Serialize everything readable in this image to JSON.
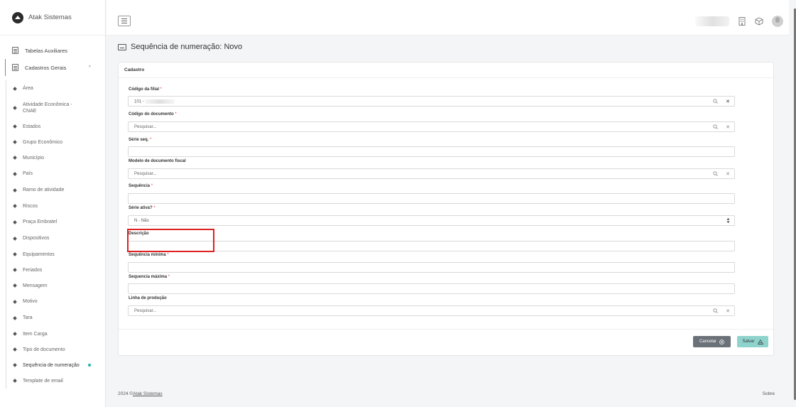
{
  "brand": {
    "name": "Atak Sistemas"
  },
  "sidebar": {
    "sections": [
      {
        "label": "Tabelas Auxiliares"
      },
      {
        "label": "Cadastros Gerais"
      }
    ],
    "items": [
      {
        "label": "Área"
      },
      {
        "label": "Atividade Econômica - CNAE"
      },
      {
        "label": "Estados"
      },
      {
        "label": "Grupo Econômico"
      },
      {
        "label": "Município"
      },
      {
        "label": "País"
      },
      {
        "label": "Ramo de atividade"
      },
      {
        "label": "Riscos"
      },
      {
        "label": "Praça Embratel"
      },
      {
        "label": "Dispositivos"
      },
      {
        "label": "Equipamentos"
      },
      {
        "label": "Feriados"
      },
      {
        "label": "Mensagem"
      },
      {
        "label": "Motivo"
      },
      {
        "label": "Tara"
      },
      {
        "label": "Item Carga"
      },
      {
        "label": "Tipo de documento"
      },
      {
        "label": "Sequência de numeração"
      },
      {
        "label": "Template de email"
      }
    ],
    "active_item": "Sequência de numeração"
  },
  "page": {
    "title": "Sequência de numeração: Novo"
  },
  "form": {
    "card_title": "Cadastro",
    "fields": {
      "filial": {
        "label": "Código da filial",
        "required": "*",
        "value": "101 -"
      },
      "documento": {
        "label": "Código do documento",
        "required": "*",
        "placeholder": "Pesquisar..."
      },
      "serie": {
        "label": "Série seq.",
        "required": "*",
        "value": ""
      },
      "modelo": {
        "label": "Modelo de documento fiscal",
        "placeholder": "Pesquisar..."
      },
      "sequencia": {
        "label": "Sequência",
        "required": "*",
        "value": ""
      },
      "serie_ativa": {
        "label": "Série ativa?",
        "required": "*",
        "value": "N - Não"
      },
      "descricao": {
        "label": "Descrição",
        "value": ""
      },
      "seq_min": {
        "label": "Sequência mínima",
        "required": "*",
        "value": ""
      },
      "seq_max": {
        "label": "Sequencia máxima",
        "required": "*",
        "value": ""
      },
      "linha": {
        "label": "Linha de produção",
        "placeholder": "Pesquisar..."
      }
    },
    "buttons": {
      "cancel": "Cancelar",
      "save": "Salvar"
    }
  },
  "footer": {
    "year": "2024 ©",
    "company": "Atak Sistemas",
    "about": "Sobre"
  },
  "colors": {
    "accent": "#22b5a8",
    "save_button": "#8fd3cd",
    "cancel_button": "#6b7178",
    "highlight": "#e02020",
    "required": "#e53935"
  },
  "icons": [
    "logo-icon",
    "menu-icon",
    "building-icon",
    "box-icon",
    "avatar",
    "search-icon",
    "clear-icon",
    "select-arrow-icon"
  ]
}
